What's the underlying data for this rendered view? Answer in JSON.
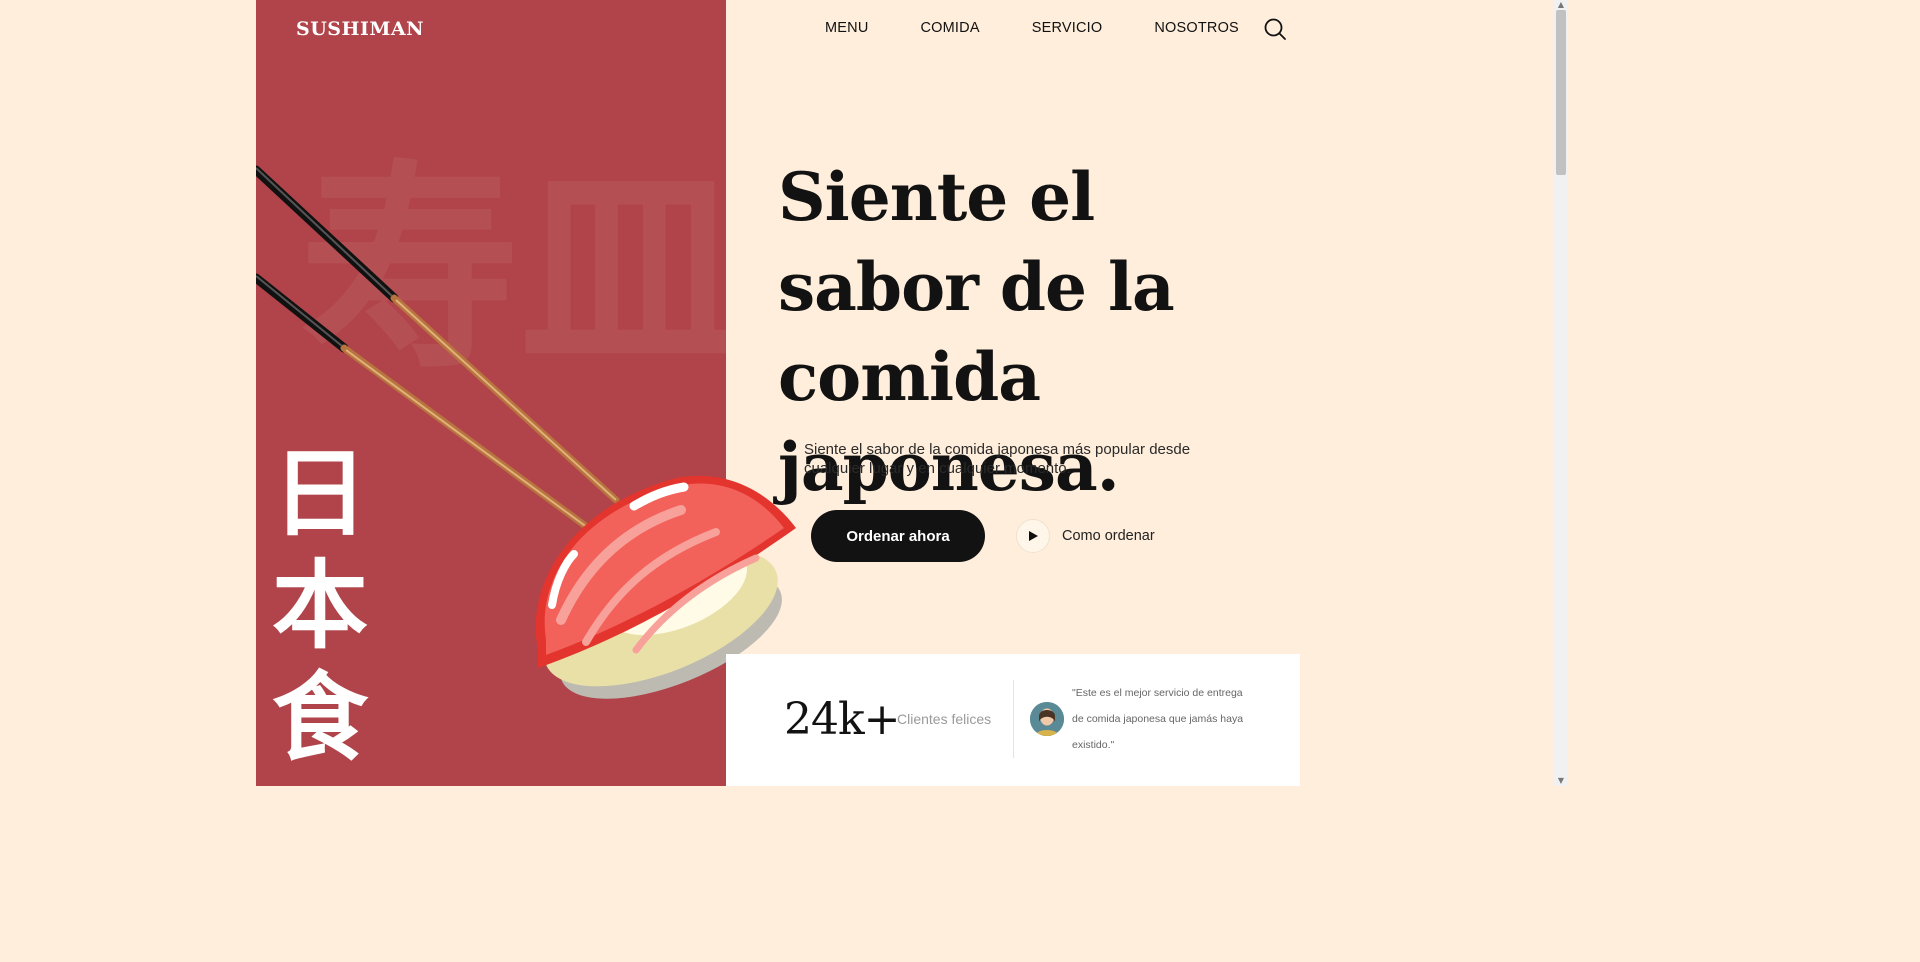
{
  "brand": {
    "logo": "SUSHIMAN"
  },
  "nav": {
    "items": [
      {
        "label": "MENU"
      },
      {
        "label": "COMIDA"
      },
      {
        "label": "SERVICIO"
      },
      {
        "label": "NOSOTROS"
      }
    ],
    "search_icon": "search-icon"
  },
  "hero": {
    "kanji": [
      "日",
      "本",
      "食"
    ],
    "headline": "Siente el sabor de la comida japonesa.",
    "subtext": "Siente el sabor de la comida japonesa más popular desde cualquier lugar y en cualquier momento.",
    "cta_primary": "Ordenar ahora",
    "cta_secondary": "Como ordenar"
  },
  "stats": {
    "value": "24k+",
    "label": "Clientes felices",
    "quote": "\"Este es el mejor servicio de entrega de comida japonesa que jamás haya existido.\""
  },
  "colors": {
    "background": "#feeedb",
    "panel_red": "#b0444a",
    "button_dark": "#121212",
    "card": "#ffffff"
  }
}
